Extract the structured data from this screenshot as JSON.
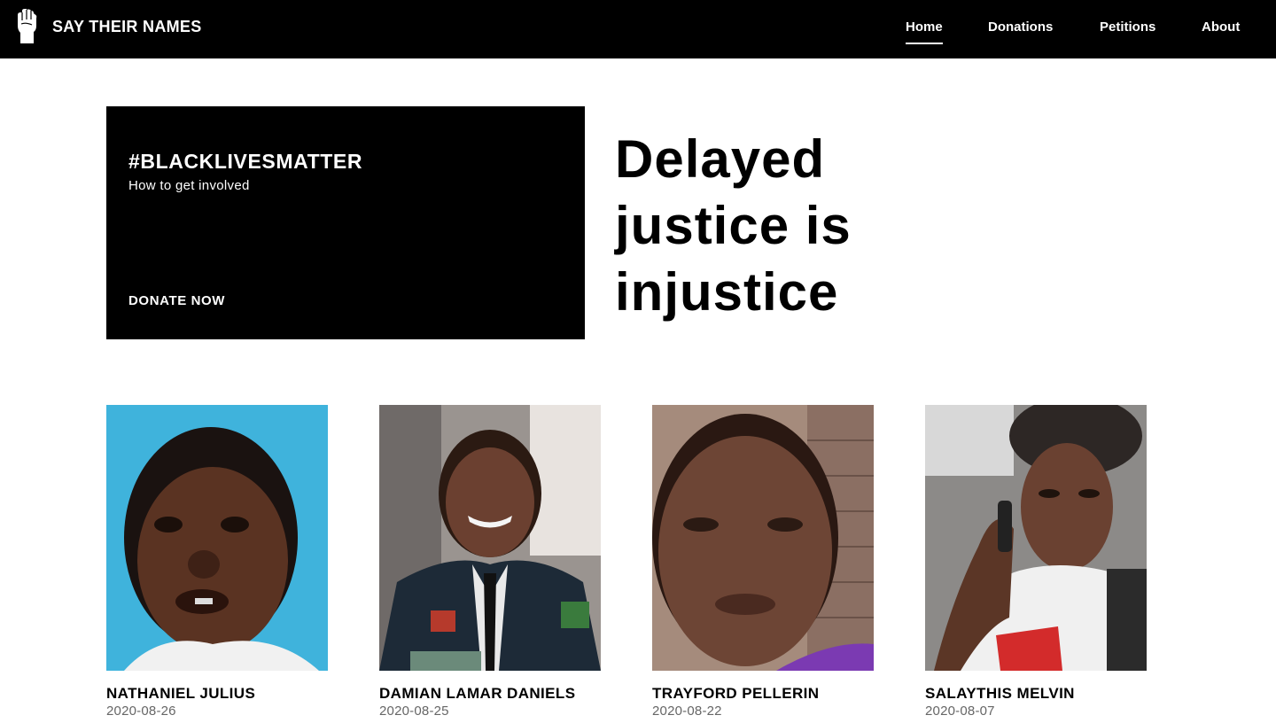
{
  "brand": {
    "name": "SAY THEIR NAMES",
    "logo_icon": "raised-fist-icon"
  },
  "nav": {
    "items": [
      {
        "label": "Home",
        "active": true
      },
      {
        "label": "Donations",
        "active": false
      },
      {
        "label": "Petitions",
        "active": false
      },
      {
        "label": "About",
        "active": false
      }
    ]
  },
  "promo": {
    "title": "#BLACKLIVESMATTER",
    "subtitle": "How to get involved",
    "cta": "DONATE NOW"
  },
  "headline": {
    "lines": [
      "Delayed",
      "justice is",
      "injustice"
    ]
  },
  "people": [
    {
      "name": "NATHANIEL JULIUS",
      "date": "2020-08-26"
    },
    {
      "name": "DAMIAN LAMAR DANIELS",
      "date": "2020-08-25"
    },
    {
      "name": "TRAYFORD PELLERIN",
      "date": "2020-08-22"
    },
    {
      "name": "SALAYTHIS MELVIN",
      "date": "2020-08-07"
    }
  ],
  "colors": {
    "nav_background": "#000000",
    "nav_text": "#ffffff",
    "card_background": "#000000",
    "date_text": "#666666"
  }
}
